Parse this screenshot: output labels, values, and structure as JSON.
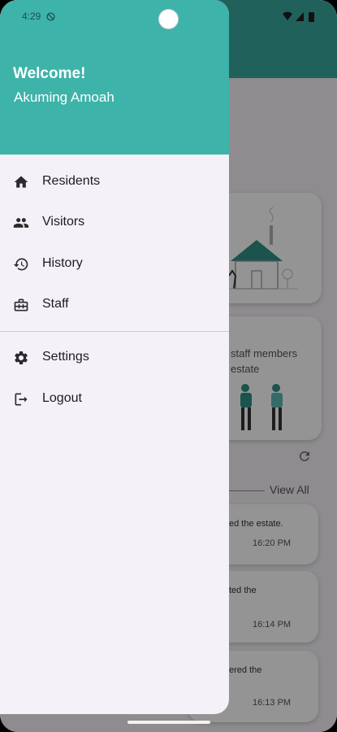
{
  "status_bar": {
    "time": "4:29"
  },
  "drawer": {
    "header": {
      "welcome": "Welcome!",
      "user_name": "Akuming Amoah"
    },
    "items": [
      {
        "label": "Residents",
        "icon": "home-icon"
      },
      {
        "label": "Visitors",
        "icon": "people-icon"
      },
      {
        "label": "History",
        "icon": "history-icon"
      },
      {
        "label": "Staff",
        "icon": "briefcase-icon"
      },
      {
        "label": "Settings",
        "icon": "gear-icon"
      },
      {
        "label": "Logout",
        "icon": "logout-icon"
      }
    ]
  },
  "background": {
    "staff_card_text": "staff members estate",
    "view_all": "View All",
    "notifications": [
      {
        "text": "ed the estate.",
        "time": "16:20 PM"
      },
      {
        "text": "ted the",
        "time": "16:14 PM"
      },
      {
        "text": "ered the",
        "time": "16:13 PM"
      }
    ]
  },
  "colors": {
    "drawer_header": "#3eb3aa",
    "app_bar": "#3aa79d",
    "drawer_bg": "#f5f1f9"
  }
}
